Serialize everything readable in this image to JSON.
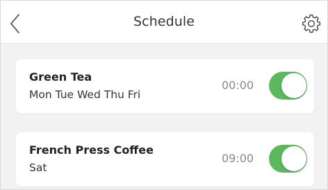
{
  "header": {
    "title": "Schedule",
    "back_icon": "chevron-left-icon",
    "settings_icon": "gear-icon"
  },
  "schedules": [
    {
      "name": "Green Tea",
      "days": "Mon Tue Wed Thu Fri",
      "time": "00:00",
      "enabled": true
    },
    {
      "name": "French Press Coffee",
      "days": "Sat",
      "time": "09:00",
      "enabled": true
    }
  ],
  "colors": {
    "toggle_on": "#5cb85c",
    "background": "#f2f2f2",
    "card": "#ffffff",
    "time_text": "#888888"
  }
}
